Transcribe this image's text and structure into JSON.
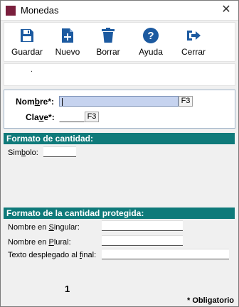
{
  "window": {
    "title": "Monedas",
    "close_glyph": "✕"
  },
  "toolbar": {
    "buttons": [
      {
        "label": "Guardar",
        "icon": "save-icon"
      },
      {
        "label": "Nuevo",
        "icon": "new-document-icon"
      },
      {
        "label": "Borrar",
        "icon": "trash-icon"
      },
      {
        "label": "Ayuda",
        "icon": "help-icon"
      },
      {
        "label": "Cerrar",
        "icon": "exit-icon"
      }
    ],
    "icon_color": "#1c5aa0"
  },
  "strip": {
    "mark": "."
  },
  "keys": {
    "nombre_label_pre": "Nom",
    "nombre_label_u": "b",
    "nombre_label_post": "re*:",
    "nombre_value": "",
    "clave_label_pre": "Cla",
    "clave_label_u": "v",
    "clave_label_post": "e*:",
    "clave_value": "",
    "f3_label": "F3"
  },
  "formato_cantidad": {
    "header": "Formato de cantidad:",
    "simbolo_label_pre": "Sim",
    "simbolo_label_u": "b",
    "simbolo_label_post": "olo:",
    "simbolo_value": ""
  },
  "formato_protegida": {
    "header": "Formato de la cantidad protegida:",
    "singular_label_pre": "Nombre en ",
    "singular_label_u": "S",
    "singular_label_post": "ingular:",
    "singular_value": "",
    "plural_label_pre": "Nombre en ",
    "plural_label_u": "P",
    "plural_label_post": "lural:",
    "plural_value": "",
    "final_label_pre": "Texto desplegado al ",
    "final_label_u": "f",
    "final_label_post": "inal:",
    "final_value": ""
  },
  "footer": {
    "page_number": "1",
    "required_note": "* Obligatorio"
  },
  "colors": {
    "section_header": "#0f7a7a",
    "selected_field": "#c6d3ef",
    "app_icon": "#7a1f3d"
  }
}
